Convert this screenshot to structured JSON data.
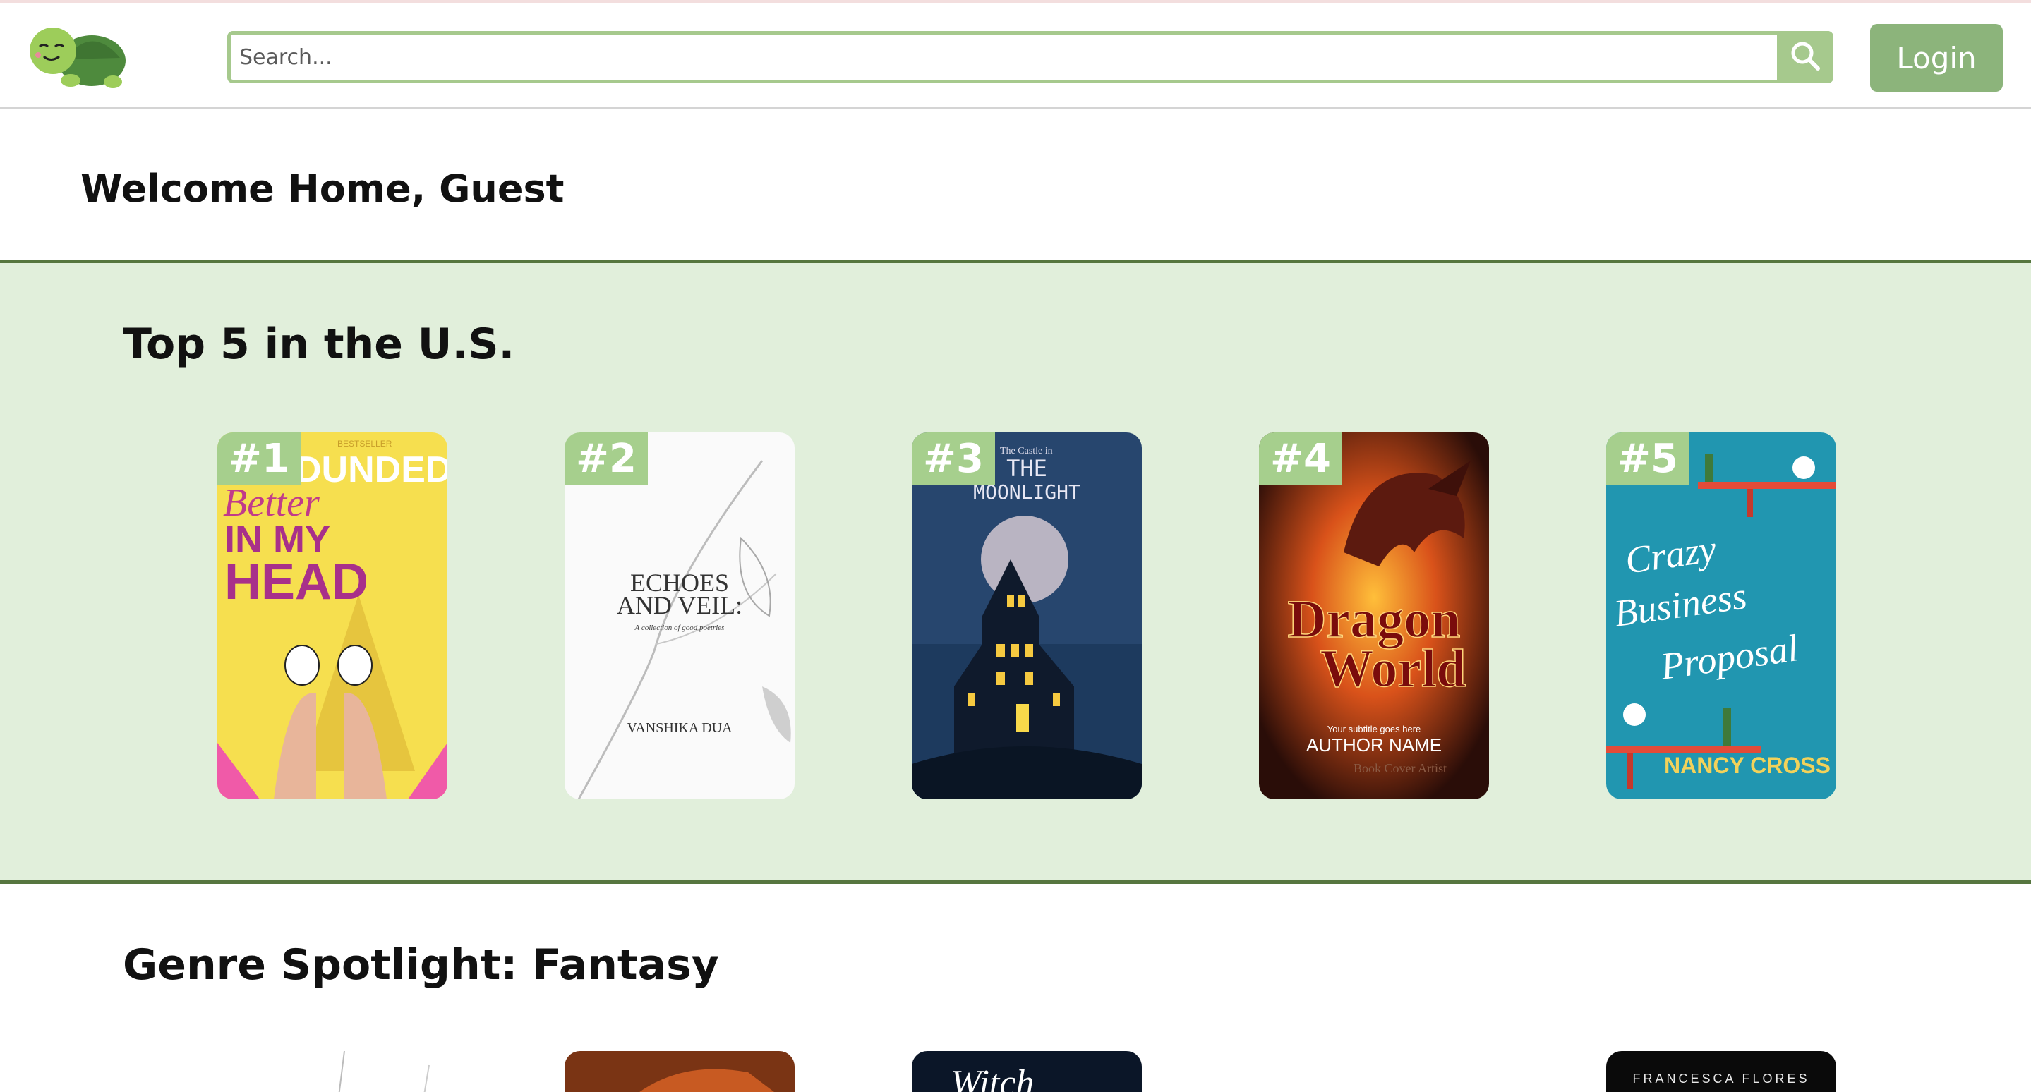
{
  "header": {
    "search_placeholder": "Search...",
    "login_label": "Login"
  },
  "welcome": "Welcome Home, Guest",
  "top5": {
    "title": "Top 5 in the U.S.",
    "books": [
      {
        "rank": "#1",
        "cover_text": [
          "BESTSELLER",
          "DUNDED",
          "Better",
          "IN MY",
          "HEAD"
        ]
      },
      {
        "rank": "#2",
        "cover_text": [
          "ECHOES",
          "AND VEIL:",
          "A collection of good poetries",
          "VANSHIKA DUA"
        ]
      },
      {
        "rank": "#3",
        "cover_text": [
          "The Castle in",
          "THE",
          "MOONLIGHT"
        ]
      },
      {
        "rank": "#4",
        "cover_text": [
          "Dragon",
          "World",
          "Your subtitle goes here",
          "AUTHOR NAME",
          "Book Cover Artist"
        ]
      },
      {
        "rank": "#5",
        "cover_text": [
          "Crazy",
          "Business",
          "Proposal",
          "NANCY CROSS"
        ]
      }
    ]
  },
  "spotlight": {
    "title": "Genre Spotlight: Fantasy",
    "peek_texts": [
      "Witch",
      "FRANCESCA FLORES"
    ]
  },
  "colors": {
    "accent": "#a6c98d",
    "button": "#8cb47b",
    "section_bg": "#e1efdb",
    "section_border": "#56763f",
    "rank_badge": "#a6cf8d"
  },
  "icons": [
    "turtle-logo-icon",
    "search-icon"
  ]
}
